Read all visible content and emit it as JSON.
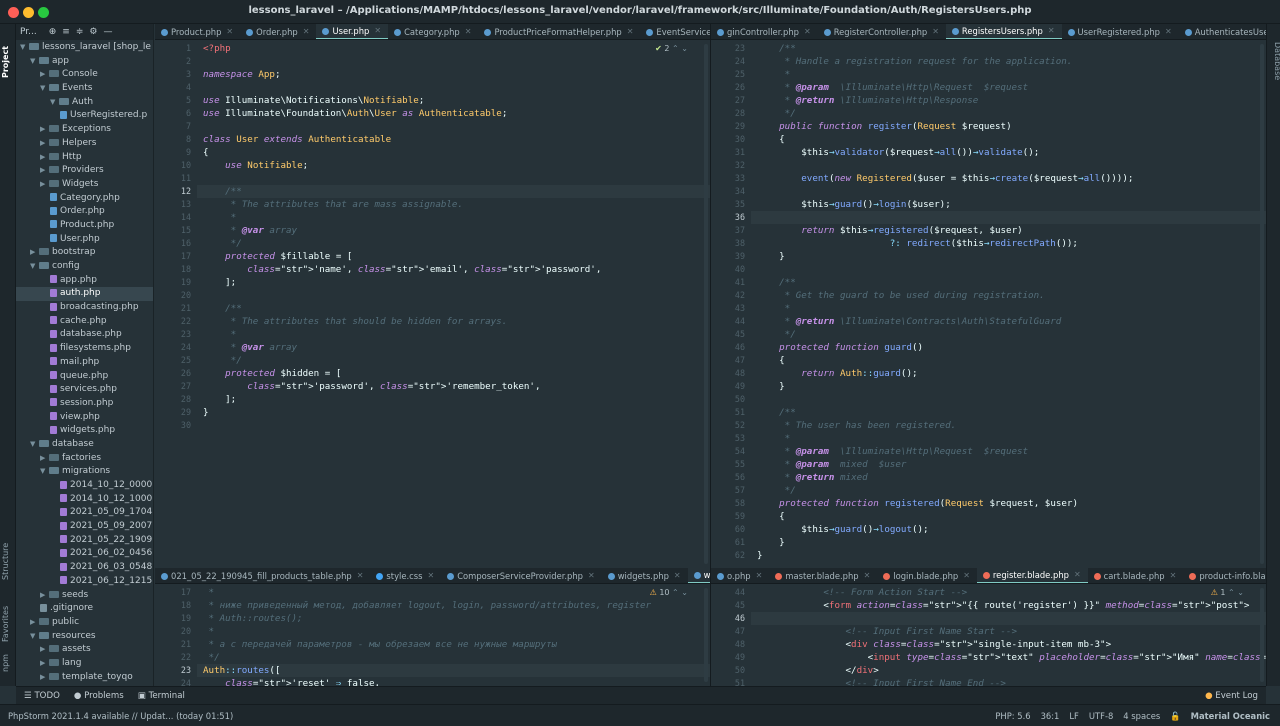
{
  "window": {
    "title": "lessons_laravel – /Applications/MAMP/htdocs/lessons_laravel/vendor/laravel/framework/src/Illuminate/Foundation/Auth/RegistersUsers.php"
  },
  "colors": {
    "bg": "#263238",
    "panel": "#1e272c",
    "accent": "#80cbc4",
    "keyword": "#c792ea",
    "class": "#ffcb6b",
    "function": "#82aaff",
    "string": "#c3e88d",
    "comment": "#546e7a"
  },
  "project": {
    "header": "Pr...",
    "root": "lessons_laravel [shop_le",
    "items": [
      {
        "label": "lessons_laravel [shop_le",
        "indent": 0,
        "type": "folder",
        "open": true
      },
      {
        "label": "app",
        "indent": 1,
        "type": "folder",
        "open": true
      },
      {
        "label": "Console",
        "indent": 2,
        "type": "folder",
        "open": false
      },
      {
        "label": "Events",
        "indent": 2,
        "type": "folder",
        "open": true
      },
      {
        "label": "Auth",
        "indent": 3,
        "type": "folder",
        "open": true
      },
      {
        "label": "UserRegistered.p",
        "indent": 4,
        "type": "file",
        "color": "#5a9bcf"
      },
      {
        "label": "Exceptions",
        "indent": 2,
        "type": "folder",
        "open": false
      },
      {
        "label": "Helpers",
        "indent": 2,
        "type": "folder",
        "open": false
      },
      {
        "label": "Http",
        "indent": 2,
        "type": "folder",
        "open": false
      },
      {
        "label": "Providers",
        "indent": 2,
        "type": "folder",
        "open": false
      },
      {
        "label": "Widgets",
        "indent": 2,
        "type": "folder",
        "open": false
      },
      {
        "label": "Category.php",
        "indent": 3,
        "type": "file",
        "color": "#5a9bcf"
      },
      {
        "label": "Order.php",
        "indent": 3,
        "type": "file",
        "color": "#5a9bcf"
      },
      {
        "label": "Product.php",
        "indent": 3,
        "type": "file",
        "color": "#5a9bcf"
      },
      {
        "label": "User.php",
        "indent": 3,
        "type": "file",
        "color": "#5a9bcf"
      },
      {
        "label": "bootstrap",
        "indent": 1,
        "type": "folder",
        "open": false
      },
      {
        "label": "config",
        "indent": 1,
        "type": "folder",
        "open": true
      },
      {
        "label": "app.php",
        "indent": 3,
        "type": "file",
        "color": "#a27bd6"
      },
      {
        "label": "auth.php",
        "indent": 3,
        "type": "file",
        "color": "#a27bd6",
        "selected": true
      },
      {
        "label": "broadcasting.php",
        "indent": 3,
        "type": "file",
        "color": "#a27bd6"
      },
      {
        "label": "cache.php",
        "indent": 3,
        "type": "file",
        "color": "#a27bd6"
      },
      {
        "label": "database.php",
        "indent": 3,
        "type": "file",
        "color": "#a27bd6"
      },
      {
        "label": "filesystems.php",
        "indent": 3,
        "type": "file",
        "color": "#a27bd6"
      },
      {
        "label": "mail.php",
        "indent": 3,
        "type": "file",
        "color": "#a27bd6"
      },
      {
        "label": "queue.php",
        "indent": 3,
        "type": "file",
        "color": "#a27bd6"
      },
      {
        "label": "services.php",
        "indent": 3,
        "type": "file",
        "color": "#a27bd6"
      },
      {
        "label": "session.php",
        "indent": 3,
        "type": "file",
        "color": "#a27bd6"
      },
      {
        "label": "view.php",
        "indent": 3,
        "type": "file",
        "color": "#a27bd6"
      },
      {
        "label": "widgets.php",
        "indent": 3,
        "type": "file",
        "color": "#a27bd6"
      },
      {
        "label": "database",
        "indent": 1,
        "type": "folder",
        "open": true
      },
      {
        "label": "factories",
        "indent": 2,
        "type": "folder",
        "open": false
      },
      {
        "label": "migrations",
        "indent": 2,
        "type": "folder",
        "open": true
      },
      {
        "label": "2014_10_12_0000",
        "indent": 4,
        "type": "file",
        "color": "#a27bd6"
      },
      {
        "label": "2014_10_12_1000",
        "indent": 4,
        "type": "file",
        "color": "#a27bd6"
      },
      {
        "label": "2021_05_09_1704",
        "indent": 4,
        "type": "file",
        "color": "#a27bd6"
      },
      {
        "label": "2021_05_09_2007",
        "indent": 4,
        "type": "file",
        "color": "#a27bd6"
      },
      {
        "label": "2021_05_22_1909",
        "indent": 4,
        "type": "file",
        "color": "#a27bd6"
      },
      {
        "label": "2021_06_02_0456",
        "indent": 4,
        "type": "file",
        "color": "#a27bd6"
      },
      {
        "label": "2021_06_03_0548",
        "indent": 4,
        "type": "file",
        "color": "#a27bd6"
      },
      {
        "label": "2021_06_12_1215",
        "indent": 4,
        "type": "file",
        "color": "#a27bd6"
      },
      {
        "label": "seeds",
        "indent": 2,
        "type": "folder",
        "open": false
      },
      {
        "label": ".gitignore",
        "indent": 2,
        "type": "file",
        "color": "#78909c"
      },
      {
        "label": "public",
        "indent": 1,
        "type": "folder",
        "open": false
      },
      {
        "label": "resources",
        "indent": 1,
        "type": "folder",
        "open": true
      },
      {
        "label": "assets",
        "indent": 2,
        "type": "folder",
        "open": false
      },
      {
        "label": "lang",
        "indent": 2,
        "type": "folder",
        "open": false
      },
      {
        "label": "template_toyqo",
        "indent": 2,
        "type": "folder",
        "open": false
      }
    ]
  },
  "left_strip": {
    "project": "Project",
    "structure": "Structure",
    "favorites": "Favorites",
    "npm": "npm"
  },
  "right_strip": {
    "database": "Database"
  },
  "top_left_tabs": [
    {
      "label": "Product.php",
      "active": false
    },
    {
      "label": "Order.php",
      "active": false
    },
    {
      "label": "User.php",
      "active": true
    },
    {
      "label": "Category.php",
      "active": false
    },
    {
      "label": "ProductPriceFormatHelper.php",
      "active": false
    },
    {
      "label": "EventServiceProvi",
      "active": false
    }
  ],
  "top_right_tabs": [
    {
      "label": "ginController.php",
      "active": false
    },
    {
      "label": "RegisterController.php",
      "active": false
    },
    {
      "label": "RegistersUsers.php",
      "active": true
    },
    {
      "label": "UserRegistered.php",
      "active": false
    },
    {
      "label": "AuthenticatesUsers.php",
      "active": false
    }
  ],
  "bottom_left_tabs": [
    {
      "label": "021_05_22_190945_fill_products_table.php",
      "active": false
    },
    {
      "label": "style.css",
      "active": false
    },
    {
      "label": "ComposerServiceProvider.php",
      "active": false
    },
    {
      "label": "widgets.php",
      "active": false
    },
    {
      "label": "web.php",
      "active": true
    }
  ],
  "bottom_right_tabs": [
    {
      "label": "o.php",
      "active": false
    },
    {
      "label": "master.blade.php",
      "active": false
    },
    {
      "label": "login.blade.php",
      "active": false
    },
    {
      "label": "register.blade.php",
      "active": true
    },
    {
      "label": "cart.blade.php",
      "active": false
    },
    {
      "label": "product-info.blade.php",
      "active": false
    }
  ],
  "editor_user": {
    "inspection": "2",
    "start": 1,
    "current": 12,
    "lines": [
      "<?php",
      "",
      "namespace App;",
      "",
      "use Illuminate\\Notifications\\Notifiable;",
      "use Illuminate\\Foundation\\Auth\\User as Authenticatable;",
      "",
      "class User extends Authenticatable",
      "{",
      "    use Notifiable;",
      "",
      "    /**",
      "     * The attributes that are mass assignable.",
      "     *",
      "     * @var array",
      "     */",
      "    protected $fillable = [",
      "        'name', 'email', 'password',",
      "    ];",
      "",
      "    /**",
      "     * The attributes that should be hidden for arrays.",
      "     *",
      "     * @var array",
      "     */",
      "    protected $hidden = [",
      "        'password', 'remember_token',",
      "    ];",
      "}",
      ""
    ]
  },
  "editor_registers": {
    "start": 23,
    "current": 36,
    "lines": [
      "    /**",
      "     * Handle a registration request for the application.",
      "     *",
      "     * @param  \\Illuminate\\Http\\Request  $request",
      "     * @return \\Illuminate\\Http\\Response",
      "     */",
      "    public function register(Request $request)",
      "    {",
      "        $this→validator($request→all())→validate();",
      "",
      "        event(new Registered($user = $this→create($request→all())));",
      "",
      "        $this→guard()→login($user);",
      "",
      "        return $this→registered($request, $user)",
      "                        ?: redirect($this→redirectPath());",
      "    }",
      "",
      "    /**",
      "     * Get the guard to be used during registration.",
      "     *",
      "     * @return \\Illuminate\\Contracts\\Auth\\StatefulGuard",
      "     */",
      "    protected function guard()",
      "    {",
      "        return Auth::guard();",
      "    }",
      "",
      "    /**",
      "     * The user has been registered.",
      "     *",
      "     * @param  \\Illuminate\\Http\\Request  $request",
      "     * @param  mixed  $user",
      "     * @return mixed",
      "     */",
      "    protected function registered(Request $request, $user)",
      "    {",
      "        $this→guard()→logout();",
      "    }",
      "}"
    ]
  },
  "editor_web": {
    "inspection": "10",
    "start": 17,
    "current": 23,
    "lines": [
      " *",
      " * ниже приведенный метод, добавляет logout, login, password/attributes, register",
      " * Auth::routes();",
      " *",
      " * а с передачей параметров - мы обрезаем все не нужные маршруты",
      " */",
      "Auth::routes([",
      "    'reset' ⇒ false,"
    ]
  },
  "editor_register": {
    "inspection": "1",
    "nums": [
      "44",
      "45",
      "46",
      "47",
      "48",
      "49",
      "50",
      "51"
    ],
    "current": 2,
    "lines": [
      "            <!-- Form Action Start -->",
      "            <form action=\"{{ route('register') }}\" method=\"post\">",
      "",
      "                <!-- Input First Name Start -->",
      "                <div class=\"single-input-item mb-3\">",
      "                    <input type=\"text\" placeholder=\"Имя\" name=\"name\">",
      "                </div>",
      "                <!-- Input First Name End -->"
    ]
  },
  "toolbar": {
    "todo": "TODO",
    "problems": "Problems",
    "terminal": "Terminal",
    "event_log": "Event Log"
  },
  "status": {
    "message": "PhpStorm 2021.1.4 available // Updat... (today 01:51)",
    "php": "PHP: 5.6",
    "position": "36:1",
    "line_sep": "LF",
    "encoding": "UTF-8",
    "indent": "4 spaces",
    "theme": "Material Oceanic"
  }
}
